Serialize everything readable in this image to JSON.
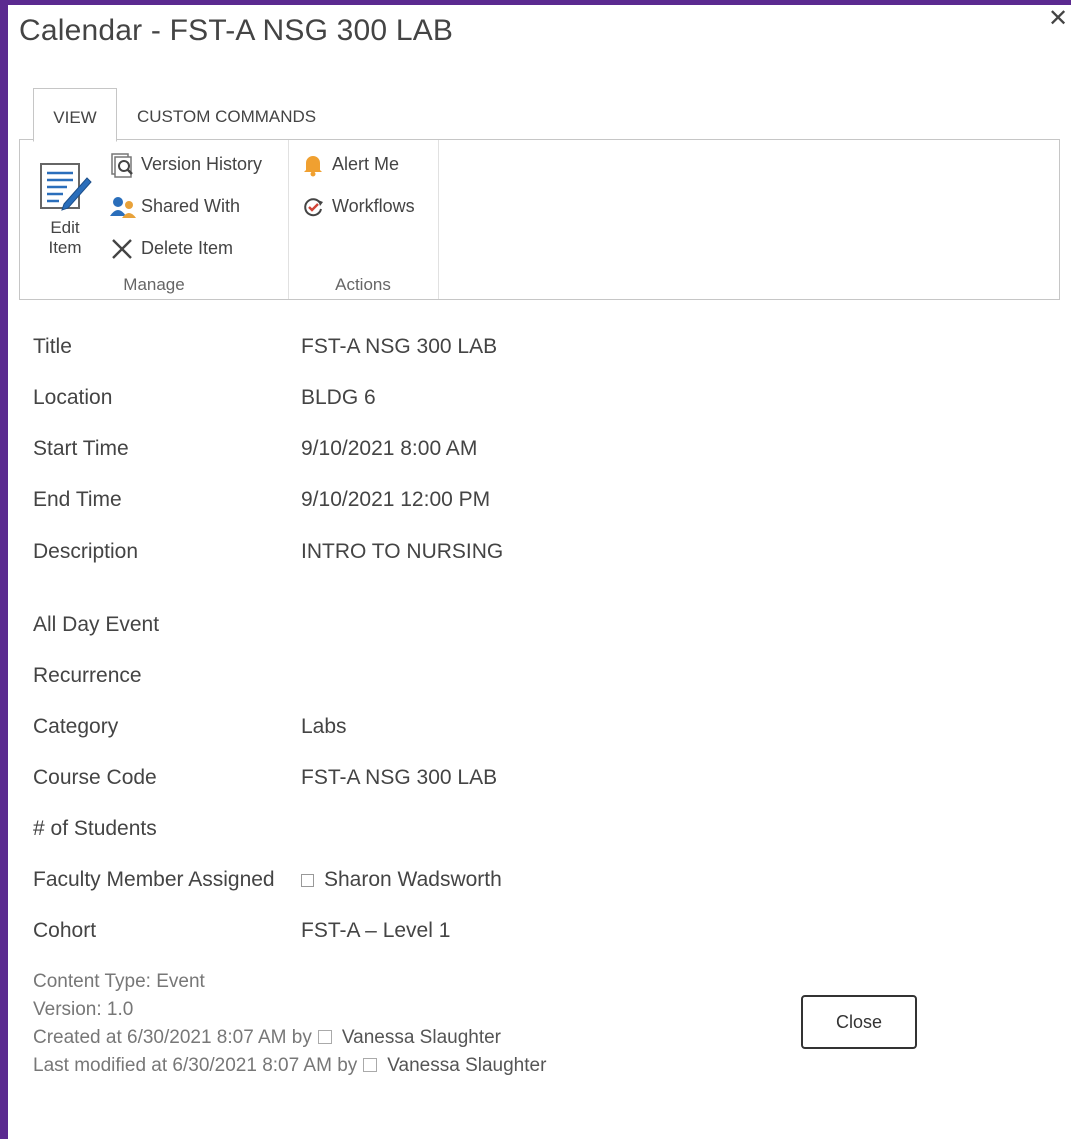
{
  "dialog": {
    "title": "Calendar - FST-A NSG 300 LAB"
  },
  "ribbon": {
    "tabs": [
      {
        "label": "VIEW",
        "active": true
      },
      {
        "label": "CUSTOM COMMANDS",
        "active": false
      }
    ],
    "groups": {
      "manage": {
        "label": "Manage",
        "edit_item": {
          "label_line1": "Edit",
          "label_line2": "Item",
          "icon": "edit-item-icon"
        },
        "version_history": {
          "label": "Version History",
          "icon": "version-history-icon"
        },
        "shared_with": {
          "label": "Shared With",
          "icon": "shared-with-icon"
        },
        "delete_item": {
          "label": "Delete Item",
          "icon": "delete-x-icon"
        }
      },
      "actions": {
        "label": "Actions",
        "alert_me": {
          "label": "Alert Me",
          "icon": "bell-icon"
        },
        "workflows": {
          "label": "Workflows",
          "icon": "workflows-icon"
        }
      }
    }
  },
  "fields": [
    {
      "label": "Title",
      "value": "FST-A NSG 300 LAB"
    },
    {
      "label": "Location",
      "value": "BLDG 6"
    },
    {
      "label": "Start Time",
      "value": "9/10/2021 8:00 AM"
    },
    {
      "label": "End Time",
      "value": "9/10/2021 12:00 PM"
    },
    {
      "label": "Description",
      "value": "INTRO TO NURSING"
    },
    {
      "label": "All Day Event",
      "value": ""
    },
    {
      "label": "Recurrence",
      "value": ""
    },
    {
      "label": "Category",
      "value": "Labs"
    },
    {
      "label": "Course Code",
      "value": "FST-A NSG 300 LAB"
    },
    {
      "label": "# of Students",
      "value": ""
    },
    {
      "label": "Faculty Member Assigned",
      "value": "Sharon Wadsworth"
    },
    {
      "label": "Cohort",
      "value": "FST-A – Level 1"
    }
  ],
  "meta": {
    "content_type": "Content Type: Event",
    "version": "Version: 1.0",
    "created_prefix": "Created at 6/30/2021 8:07 AM by",
    "created_by": "Vanessa Slaughter",
    "modified_prefix": "Last modified at 6/30/2021 8:07 AM by",
    "modified_by": "Vanessa Slaughter"
  },
  "buttons": {
    "close": "Close"
  },
  "colors": {
    "frame": "#5b2a90",
    "text": "#444444",
    "meta_text": "#777777"
  }
}
